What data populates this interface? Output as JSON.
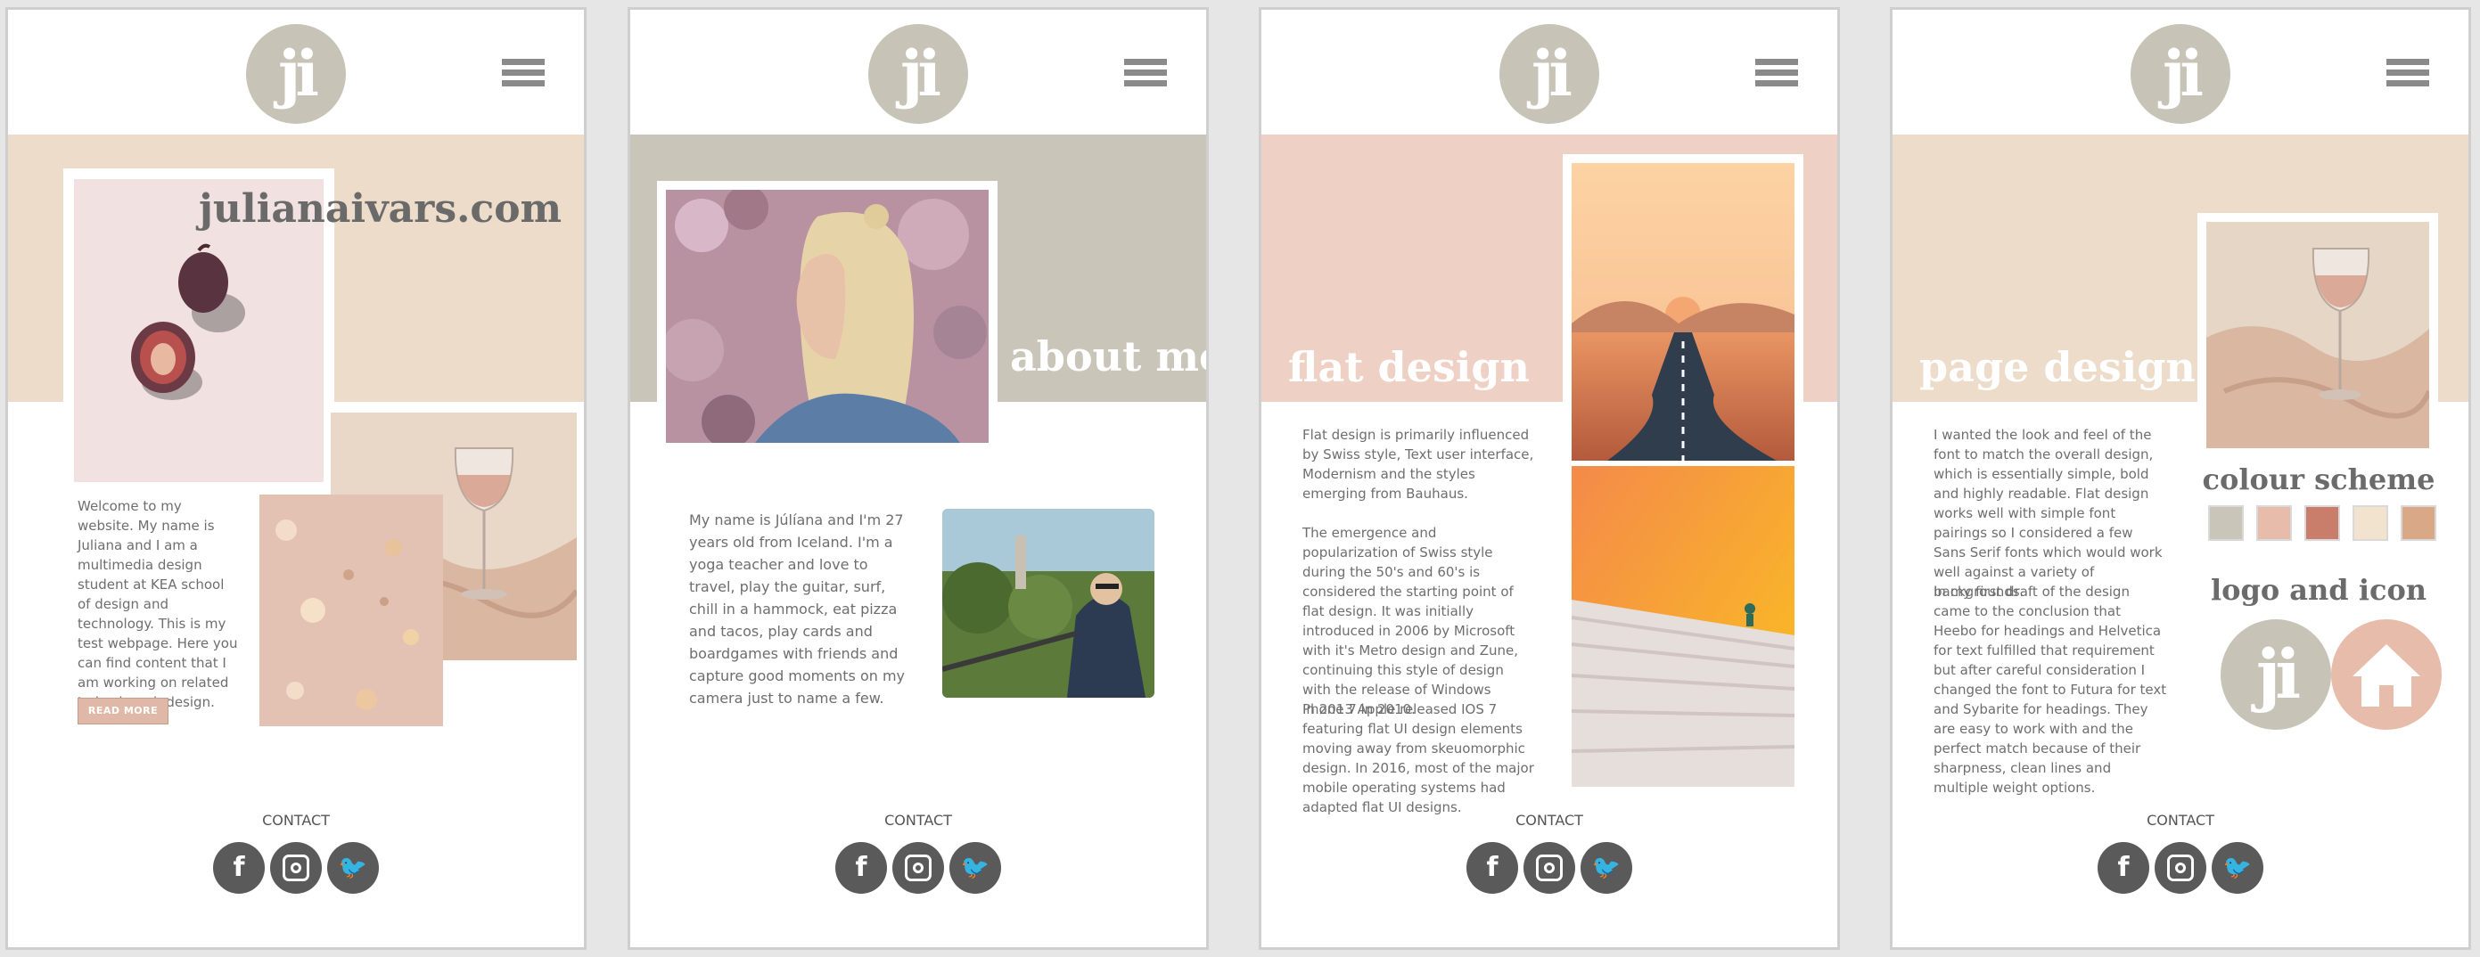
{
  "common": {
    "logo_text": "ji",
    "contact_label": "CONTACT",
    "social": {
      "facebook": "f",
      "twitter": "🐦"
    },
    "icons": [
      "logo-icon",
      "hamburger-menu-icon",
      "facebook-icon",
      "instagram-icon",
      "twitter-icon"
    ]
  },
  "home": {
    "site_title": "julianaivars.com",
    "welcome_text": "Welcome to my website. My name is Juliana and I am a multimedia design student at KEA school of design and technology. This is my test webpage. Here you can find content that I am working on related to basic web design.",
    "read_more": "READ MORE",
    "band_color": "#ecdcc9"
  },
  "about": {
    "heading": "about me",
    "text": "My name is Júlíana and I'm 27 years old from Iceland. I'm a yoga teacher and love to travel, play the guitar, surf, chill in a hammock, eat pizza and tacos, play cards and boardgames with friends and capture good moments on my camera just to name a few.",
    "band_color": "#c9c5b9"
  },
  "flat": {
    "heading": "flat design",
    "p1": "Flat design is primarily influenced by Swiss style, Text user interface, Modernism and the styles emerging from Bauhaus.",
    "p2": "The emergence and popularization of Swiss style during the 50's and 60's is considered the starting point of flat design. It was initially introduced in 2006 by Microsoft with it's Metro design and Zune, continuing this style of design with the release of Windows Phone 7 in 2010.",
    "p3": "In 2013 Apple released IOS 7 featuring flat UI design elements moving away from skeuomorphic design. In 2016, most of the major mobile operating systems had adapted flat UI designs.",
    "band_color": "#efd0c4"
  },
  "page": {
    "heading": "page design",
    "p1": "I wanted the look and feel of the font to match the overall design, which is essentially simple, bold and highly readable. Flat design works well with simple font pairings so I considered a few Sans Serif fonts which would work well against a variety of backgrounds.",
    "p2": "In my first draft of the design came to the conclusion that Heebo for headings and Helvetica for text fulfilled that requirement but after careful consideration I changed the font to Futura for text and Sybarite for headings. They are easy to work with and the perfect match because of their sharpness, clean lines and multiple weight options.",
    "colour_heading": "colour scheme",
    "logo_heading": "logo and icon",
    "swatches": [
      "#c9c5b9",
      "#e8bcaa",
      "#c97e6c",
      "#f1e3cd",
      "#d8a887"
    ],
    "band_color": "#ecdcc9",
    "home_icon_color": "#e8bcaa"
  }
}
